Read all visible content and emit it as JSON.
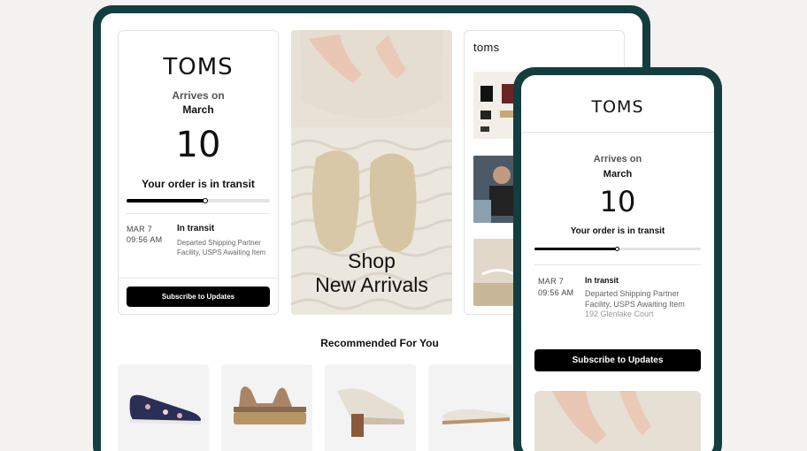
{
  "desktop": {
    "tracking": {
      "logo": "TOMS",
      "arrives_label": "Arrives on",
      "month": "March",
      "day": "10",
      "status": "Your order is in transit",
      "progress": 0.55,
      "event": {
        "date": "MAR 7",
        "time": "09:56 AM",
        "title": "In transit",
        "description": "Departed Shipping Partner Facility, USPS Awaiting Item"
      },
      "subscribe_label": "Subscribe to Updates"
    },
    "promo": {
      "line1": "Shop",
      "line2": "New Arrivals"
    },
    "social": {
      "brand": "toms"
    },
    "recommended": {
      "title": "Recommended For You"
    }
  },
  "phone": {
    "logo": "TOMS",
    "arrives_label": "Arrives on",
    "month": "March",
    "day": "10",
    "status": "Your order is in transit",
    "progress": 0.5,
    "event": {
      "date": "MAR 7",
      "time": "09:56 AM",
      "title": "In transit",
      "description": "Departed Shipping Partner Facility, USPS Awaiting Item",
      "address": "192 Glenlake Court"
    },
    "subscribe_label": "Subscribe to Updates"
  },
  "colors": {
    "frame": "#143d40",
    "button": "#000000",
    "background": "#f3f2f1"
  }
}
